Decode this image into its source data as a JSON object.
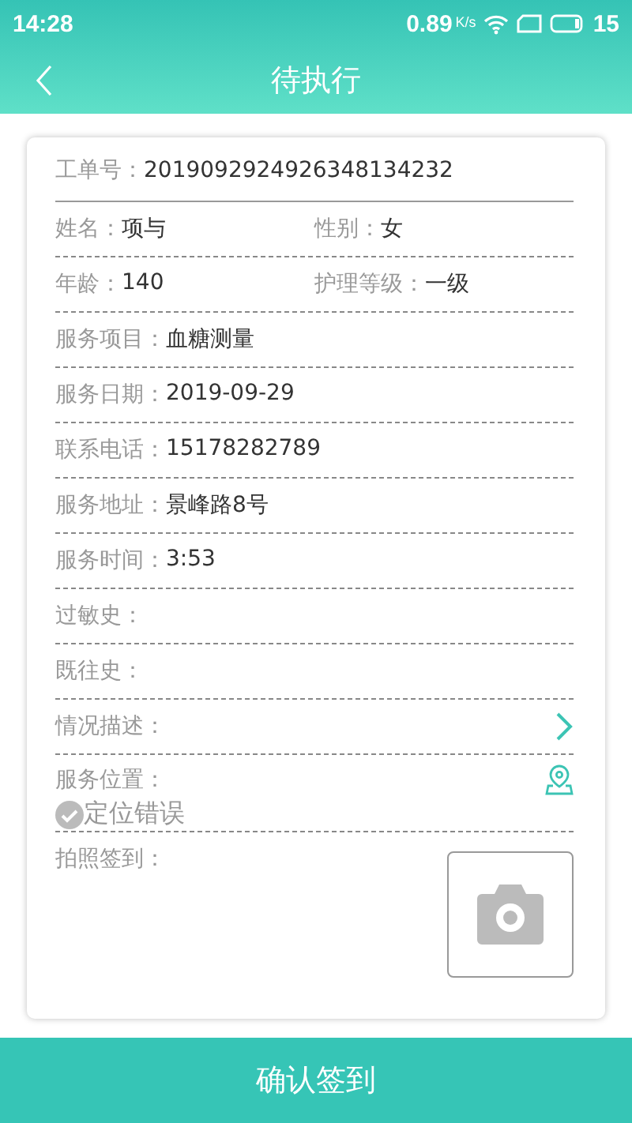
{
  "status_bar": {
    "time": "14:28",
    "speed": "0.89",
    "speed_unit": "K/s",
    "battery": "15"
  },
  "header": {
    "title": "待执行"
  },
  "order": {
    "label": "工单号：",
    "value": "2019092924926348134232"
  },
  "rows": [
    {
      "kind": "pair",
      "fields": [
        {
          "label": "姓名：",
          "value": "项与"
        },
        {
          "label": "性别：",
          "value": "女"
        }
      ]
    },
    {
      "kind": "pair",
      "fields": [
        {
          "label": "年龄：",
          "value": "140"
        },
        {
          "label": "护理等级：",
          "value": "一级"
        }
      ]
    },
    {
      "kind": "text",
      "label": "服务项目：",
      "value": "血糖测量"
    },
    {
      "kind": "text",
      "label": "服务日期：",
      "value": "2019-09-29"
    },
    {
      "kind": "text",
      "label": "联系电话：",
      "value": "15178282789"
    },
    {
      "kind": "text",
      "label": "服务地址：",
      "value": "景峰路8号"
    },
    {
      "kind": "text",
      "label": "服务时间：",
      "value": "3:53"
    },
    {
      "kind": "text",
      "label": "过敏史："
    },
    {
      "kind": "text",
      "label": "既往史："
    },
    {
      "kind": "link",
      "label": "情况描述："
    },
    {
      "kind": "location",
      "label": "服务位置：",
      "status": "定位错误"
    }
  ],
  "photo": {
    "label": "拍照签到："
  },
  "confirm_button": "确认签到"
}
